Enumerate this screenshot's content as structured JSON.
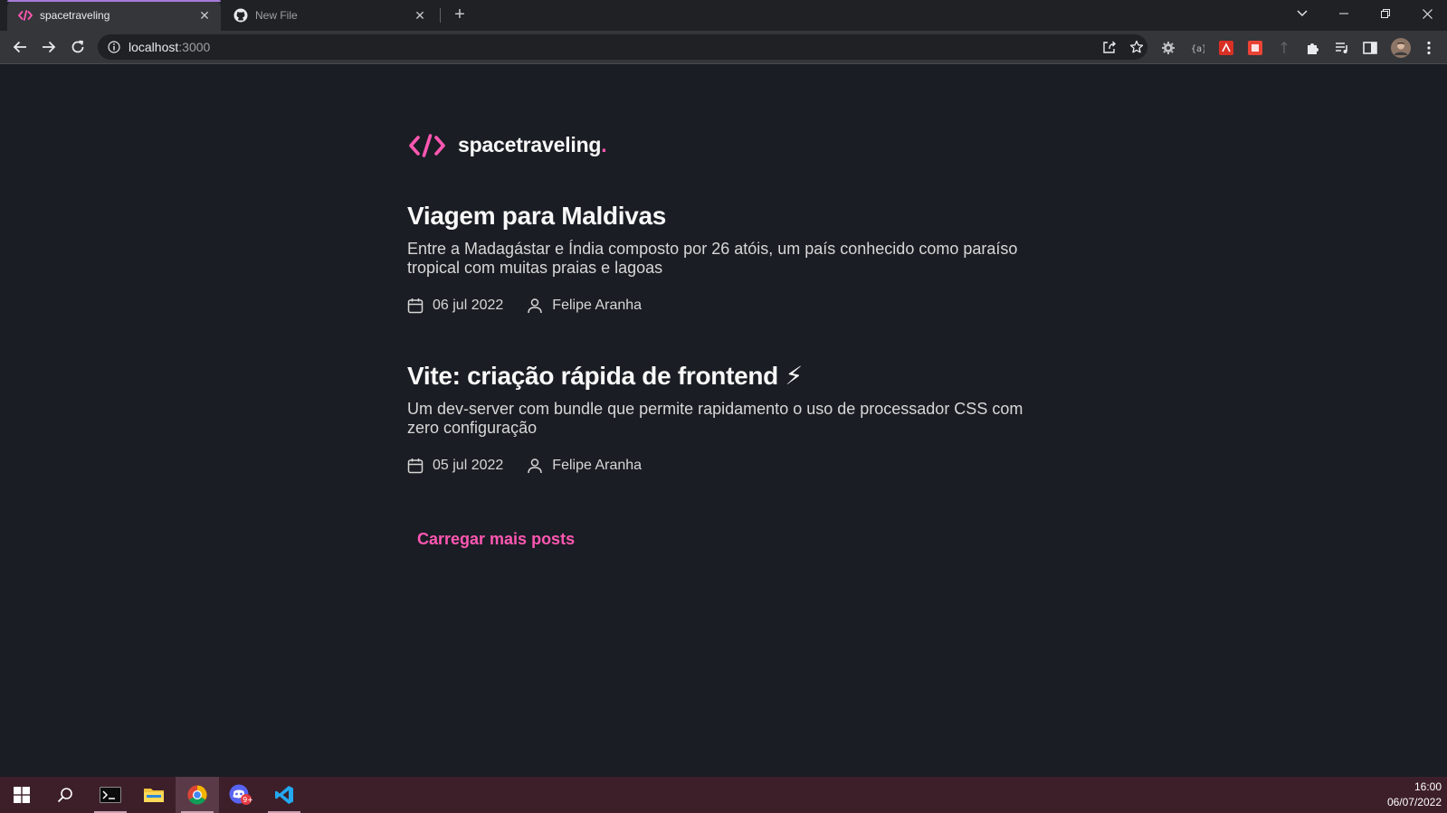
{
  "browser": {
    "tabs": [
      {
        "title": "spacetraveling",
        "favicon": "code-brackets-icon",
        "active": true
      },
      {
        "title": "New File",
        "favicon": "github-icon",
        "active": false
      }
    ],
    "url_host": "localhost",
    "url_port": ":3000"
  },
  "site": {
    "logo_text": "spacetraveling",
    "logo_dot": ".",
    "accent_color": "#ff57b2"
  },
  "posts": [
    {
      "title": "Viagem para Maldivas",
      "subtitle": "Entre a Madagástar e Índia composto por 26 atóis, um país conhecido como paraíso tropical com muitas praias e lagoas",
      "date": "06 jul 2022",
      "author": "Felipe Aranha"
    },
    {
      "title": "Vite: criação rápida de frontend ⚡",
      "subtitle": "Um dev-server com bundle que permite rapidamento o uso de processador CSS com zero configuração",
      "date": "05 jul 2022",
      "author": "Felipe Aranha"
    }
  ],
  "load_more_label": "Carregar mais posts",
  "taskbar": {
    "time": "16:00",
    "date": "06/07/2022"
  }
}
